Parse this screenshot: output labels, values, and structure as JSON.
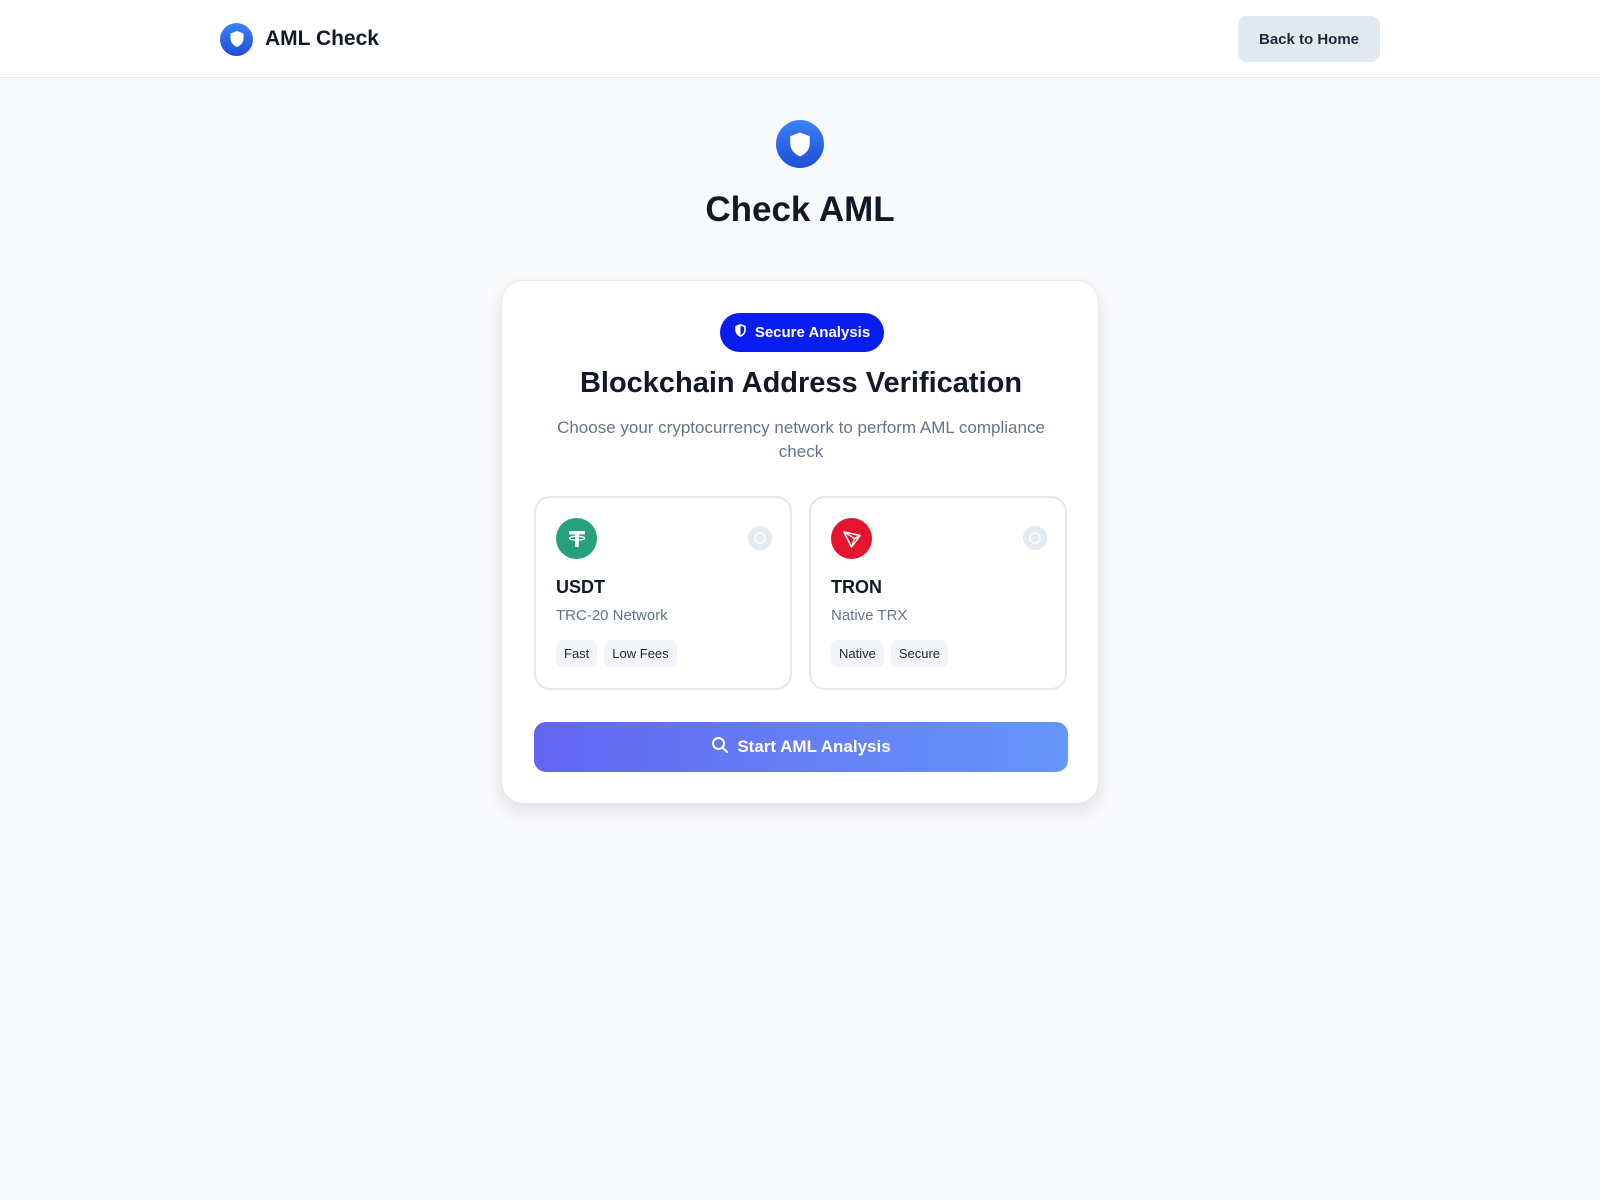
{
  "header": {
    "brand_name": "AML Check",
    "back_button_label": "Back to Home"
  },
  "hero": {
    "title": "Check AML"
  },
  "card": {
    "badge_label": "Secure Analysis",
    "title": "Blockchain Address Verification",
    "subtitle": "Choose your cryptocurrency network to perform AML compliance check",
    "options": [
      {
        "name": "USDT",
        "network": "TRC-20 Network",
        "tags": [
          "Fast",
          "Low Fees"
        ],
        "icon": "tether-icon",
        "color": "#26a17b"
      },
      {
        "name": "TRON",
        "network": "Native TRX",
        "tags": [
          "Native",
          "Secure"
        ],
        "icon": "tron-icon",
        "color": "#e5152f"
      }
    ],
    "cta_label": "Start AML Analysis"
  },
  "colors": {
    "accent": "#0a1df0",
    "brand_blue": "#2563eb",
    "cta_gradient_start": "#6366f1",
    "cta_gradient_end": "#6596f9"
  }
}
